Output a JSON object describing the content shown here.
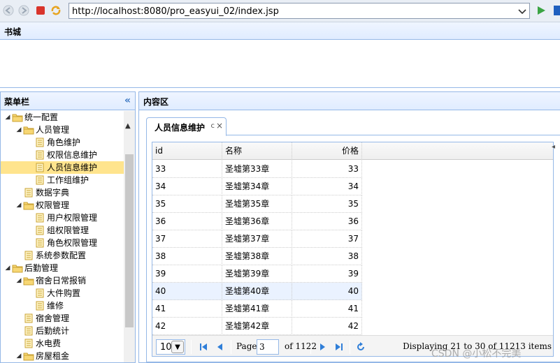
{
  "browser": {
    "url": "http://localhost:8080/pro_easyui_02/index.jsp",
    "icons": [
      "back-icon",
      "forward-icon",
      "stop-icon",
      "refresh-icon",
      "dropdown-icon",
      "go-icon"
    ]
  },
  "north": {
    "title": "书城"
  },
  "west": {
    "title": "菜单栏",
    "collapse_glyph": "«",
    "tree": [
      {
        "label": "统一配置",
        "level": 0,
        "type": "folder",
        "expanded": true
      },
      {
        "label": "人员管理",
        "level": 1,
        "type": "folder",
        "expanded": true
      },
      {
        "label": "角色维护",
        "level": 2,
        "type": "file"
      },
      {
        "label": "权限信息维护",
        "level": 2,
        "type": "file"
      },
      {
        "label": "人员信息维护",
        "level": 2,
        "type": "file",
        "selected": true
      },
      {
        "label": "工作组维护",
        "level": 2,
        "type": "file"
      },
      {
        "label": "数据字典",
        "level": 1,
        "type": "file"
      },
      {
        "label": "权限管理",
        "level": 1,
        "type": "folder",
        "expanded": true
      },
      {
        "label": "用户权限管理",
        "level": 2,
        "type": "file"
      },
      {
        "label": "组权限管理",
        "level": 2,
        "type": "file"
      },
      {
        "label": "角色权限管理",
        "level": 2,
        "type": "file"
      },
      {
        "label": "系统参数配置",
        "level": 1,
        "type": "file"
      },
      {
        "label": "后勤管理",
        "level": 0,
        "type": "folder",
        "expanded": true
      },
      {
        "label": "宿舍日常报销",
        "level": 1,
        "type": "folder",
        "expanded": true
      },
      {
        "label": "大件购置",
        "level": 2,
        "type": "file"
      },
      {
        "label": "维修",
        "level": 2,
        "type": "file"
      },
      {
        "label": "宿舍管理",
        "level": 1,
        "type": "file"
      },
      {
        "label": "后勤统计",
        "level": 1,
        "type": "file"
      },
      {
        "label": "水电费",
        "level": 1,
        "type": "file"
      },
      {
        "label": "房屋租金",
        "level": 1,
        "type": "folder",
        "expanded": true
      }
    ]
  },
  "center": {
    "title": "内容区",
    "tab": {
      "label": "人员信息维护",
      "refresh_glyph": "c",
      "close_glyph": "×"
    },
    "grid": {
      "columns": [
        "id",
        "名称",
        "价格"
      ],
      "rows": [
        [
          "33",
          "圣墟第33章",
          "33"
        ],
        [
          "34",
          "圣墟第34章",
          "34"
        ],
        [
          "35",
          "圣墟第35章",
          "35"
        ],
        [
          "36",
          "圣墟第36章",
          "36"
        ],
        [
          "37",
          "圣墟第37章",
          "37"
        ],
        [
          "38",
          "圣墟第38章",
          "38"
        ],
        [
          "39",
          "圣墟第39章",
          "39"
        ],
        [
          "40",
          "圣墟第40章",
          "40"
        ],
        [
          "41",
          "圣墟第41章",
          "41"
        ],
        [
          "42",
          "圣墟第42章",
          "42"
        ]
      ],
      "highlighted_row": 7
    },
    "pager": {
      "page_size": "10",
      "page_label": "Page",
      "page_value": "3",
      "of_label": "of 1122",
      "info": "Displaying 21 to 30 of 11213 items"
    }
  },
  "watermark": "CSDN @小松不完美",
  "colors": {
    "border": "#95b8e7",
    "header_bg": "#e0ecff",
    "selected": "#ffe48d",
    "accent": "#3c78c3"
  }
}
